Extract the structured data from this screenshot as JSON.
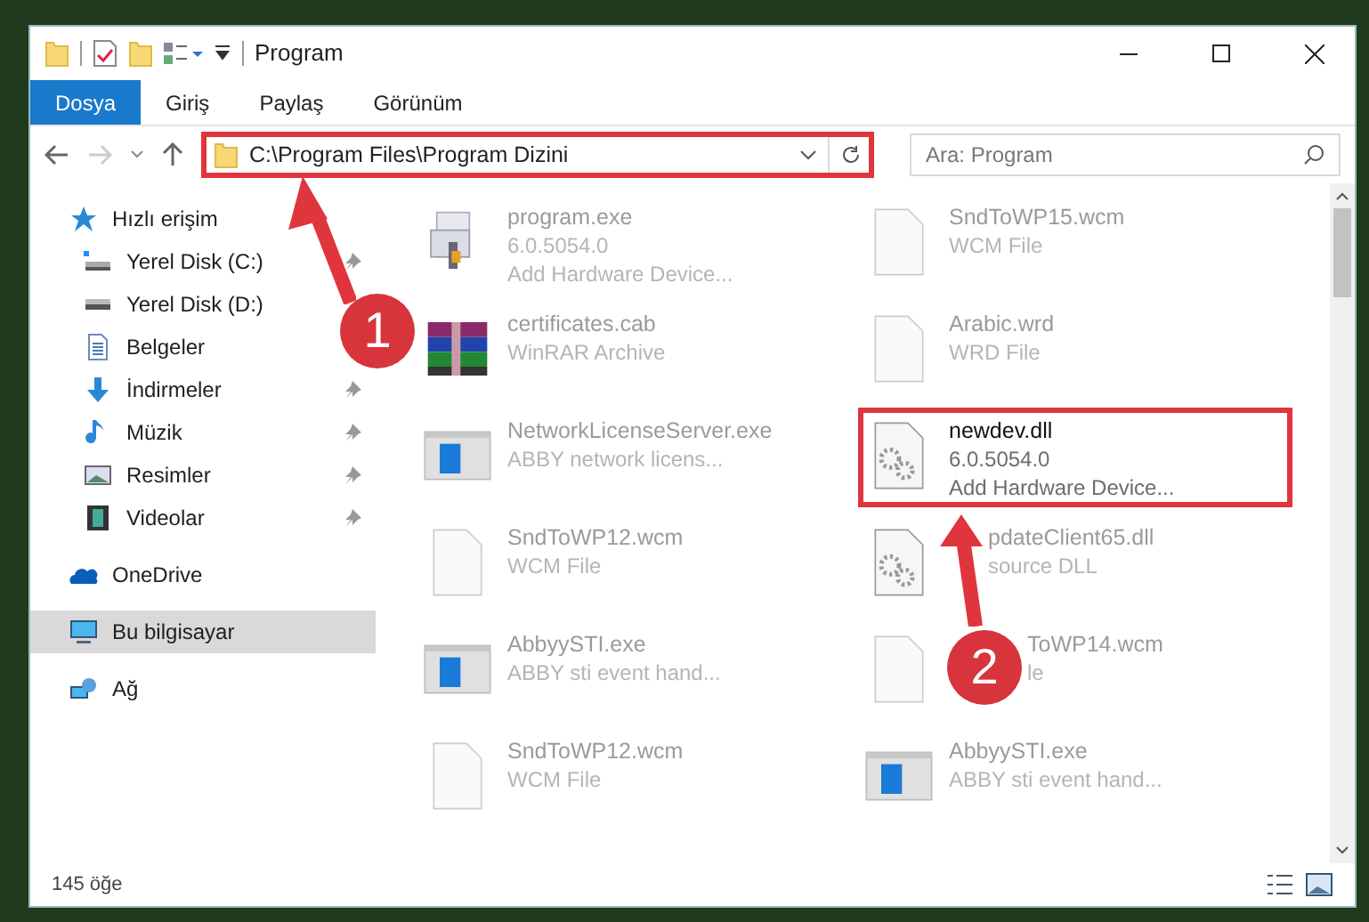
{
  "window": {
    "title": "Program"
  },
  "ribbon_tabs": [
    {
      "label": "Dosya",
      "selected": true
    },
    {
      "label": "Giriş",
      "selected": false
    },
    {
      "label": "Paylaş",
      "selected": false
    },
    {
      "label": "Görünüm",
      "selected": false
    }
  ],
  "address_bar": {
    "path": "C:\\Program Files\\Program Dizini",
    "highlighted": true
  },
  "search": {
    "placeholder": "Ara: Program"
  },
  "sidebar": {
    "items": [
      {
        "label": "Hızlı erişim",
        "kind": "star",
        "pinned": false,
        "selected": false,
        "children": [
          {
            "label": "Yerel Disk (C:)",
            "kind": "drive-c",
            "pinned": true,
            "selected": false
          },
          {
            "label": "Yerel Disk (D:)",
            "kind": "drive",
            "pinned": false,
            "selected": false
          },
          {
            "label": "Belgeler",
            "kind": "docs",
            "pinned": false,
            "selected": false
          },
          {
            "label": "İndirmeler",
            "kind": "download",
            "pinned": true,
            "selected": false
          },
          {
            "label": "Müzik",
            "kind": "music",
            "pinned": true,
            "selected": false
          },
          {
            "label": "Resimler",
            "kind": "pictures",
            "pinned": true,
            "selected": false
          },
          {
            "label": "Videolar",
            "kind": "videos",
            "pinned": true,
            "selected": false
          }
        ]
      },
      {
        "label": "OneDrive",
        "kind": "cloud",
        "pinned": false,
        "selected": false
      },
      {
        "label": "Bu bilgisayar",
        "kind": "pc",
        "pinned": false,
        "selected": true
      },
      {
        "label": "Ağ",
        "kind": "network",
        "pinned": false,
        "selected": false
      }
    ]
  },
  "files": [
    {
      "name": "program.exe",
      "lines": [
        "6.0.5054.0",
        "Add Hardware Device..."
      ],
      "kind": "app",
      "highlighted": false
    },
    {
      "name": "SndToWP15.wcm",
      "lines": [
        "WCM File"
      ],
      "kind": "blank",
      "highlighted": false
    },
    {
      "name": "certificates.cab",
      "lines": [
        "WinRAR Archive"
      ],
      "kind": "archive",
      "highlighted": false
    },
    {
      "name": "Arabic.wrd",
      "lines": [
        "WRD File"
      ],
      "kind": "blank",
      "highlighted": false
    },
    {
      "name": "NetworkLicenseServer.exe",
      "lines": [
        "ABBY network licens..."
      ],
      "kind": "window",
      "highlighted": false
    },
    {
      "name": "newdev.dll",
      "lines": [
        "6.0.5054.0",
        "Add Hardware Device..."
      ],
      "kind": "gear",
      "highlighted": true
    },
    {
      "name": "SndToWP12.wcm",
      "lines": [
        "WCM File"
      ],
      "kind": "blank",
      "highlighted": false
    },
    {
      "name": "pdateClient65.dll",
      "lines": [
        "source DLL"
      ],
      "kind": "gear",
      "highlighted": false,
      "under_arrow": true,
      "under_badge": false
    },
    {
      "name": "AbbyySTI.exe",
      "lines": [
        "ABBY sti event hand..."
      ],
      "kind": "window",
      "highlighted": false
    },
    {
      "name": "ToWP14.wcm",
      "lines": [
        "le"
      ],
      "kind": "blank",
      "highlighted": false,
      "under_arrow": false,
      "under_badge": true
    },
    {
      "name": "SndToWP12.wcm",
      "lines": [
        "WCM File"
      ],
      "kind": "blank",
      "highlighted": false
    },
    {
      "name": "AbbyySTI.exe",
      "lines": [
        "ABBY sti event hand..."
      ],
      "kind": "window",
      "highlighted": false
    }
  ],
  "status_bar": {
    "count": "145 öğe"
  },
  "callouts": [
    "1",
    "2"
  ]
}
